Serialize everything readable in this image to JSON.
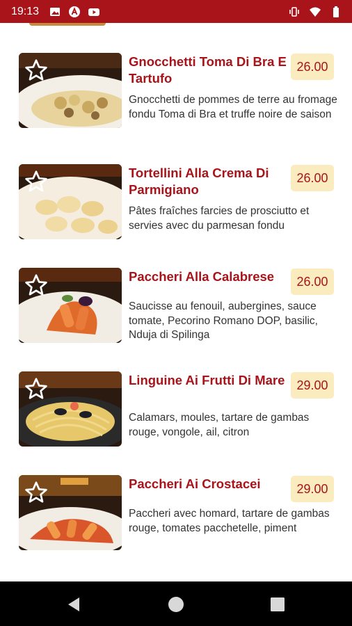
{
  "status_bar": {
    "time": "19:13",
    "left_icons": [
      "image-icon",
      "app-badge-icon",
      "youtube-icon"
    ],
    "right_icons": [
      "vibrate-icon",
      "wifi-icon",
      "battery-icon"
    ]
  },
  "colors": {
    "brand_red": "#a8141a",
    "price_bg": "#fbecc0",
    "text": "#333333"
  },
  "menu": {
    "items": [
      {
        "name": "Gnocchetti Toma Di Bra E Tartufo",
        "price": "26.00",
        "description": "Gnocchetti de pommes de terre au fromage fondu Toma di Bra et truffe noire de saison",
        "favorite_icon": "star-outline-icon"
      },
      {
        "name": "Tortellini Alla Crema Di Parmigiano",
        "price": "26.00",
        "description": "Pâtes fraîches farcies de prosciutto et servies avec du parmesan fondu",
        "favorite_icon": "star-outline-icon"
      },
      {
        "name": "Paccheri Alla Calabrese",
        "price": "26.00",
        "description": "Saucisse au fenouil, aubergines, sauce tomate, Pecorino Romano DOP, basilic, Nduja di Spilinga",
        "favorite_icon": "star-outline-icon"
      },
      {
        "name": "Linguine Ai Frutti Di Mare",
        "price": "29.00",
        "description": "Calamars, moules, tartare de gambas rouge, vongole, ail, citron",
        "favorite_icon": "star-outline-icon"
      },
      {
        "name": "Paccheri Ai Crostacei",
        "price": "29.00",
        "description": "Paccheri avec homard, tartare de gambas rouge, tomates pacchetelle, piment",
        "favorite_icon": "star-outline-icon"
      }
    ]
  },
  "nav_bar": {
    "buttons": [
      "back-icon",
      "home-icon",
      "recents-icon"
    ]
  }
}
